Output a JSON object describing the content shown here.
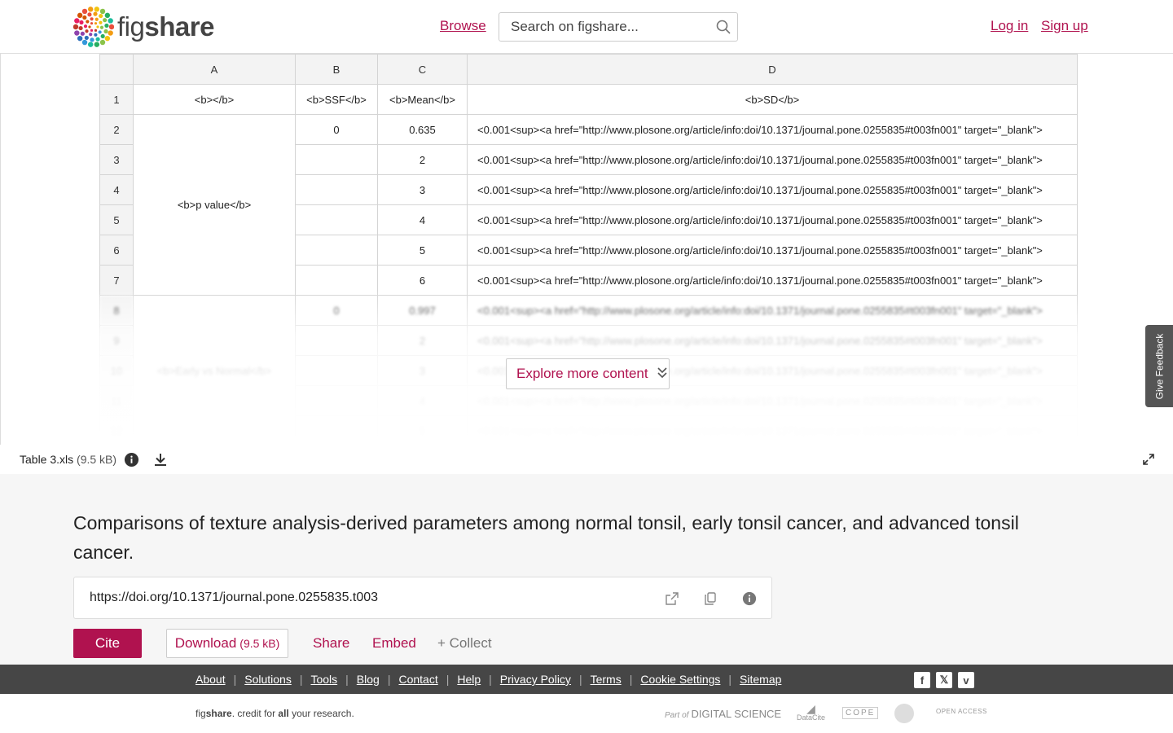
{
  "header": {
    "logo_text_fig": "fig",
    "logo_text_share": "share",
    "browse": "Browse",
    "search_placeholder": "Search on figshare...",
    "login": "Log in",
    "signup": "Sign up"
  },
  "grid": {
    "columns": [
      "A",
      "B",
      "C",
      "D"
    ],
    "header_row": {
      "num": "1",
      "a": "<b></b>",
      "b": "<b>SSF</b>",
      "c": "<b>Mean</b>",
      "d": "<b>SD</b>"
    },
    "merged_a_pvalue": "<b>p value</b>",
    "merged_a_early": "<b>Early vs Normal</b>",
    "sd_text": "<0.001<sup><a href=\"http://www.plosone.org/article/info:doi/10.1371/journal.pone.0255835#t003fn001\" target=\"_blank\">",
    "rows": [
      {
        "num": "2",
        "b": "0",
        "c": "0.635"
      },
      {
        "num": "3",
        "b": "",
        "c": "2"
      },
      {
        "num": "4",
        "b": "",
        "c": "3"
      },
      {
        "num": "5",
        "b": "",
        "c": "4"
      },
      {
        "num": "6",
        "b": "",
        "c": "5"
      },
      {
        "num": "7",
        "b": "",
        "c": "6"
      },
      {
        "num": "8",
        "b": "0",
        "c": "0.997"
      },
      {
        "num": "9",
        "b": "",
        "c": "2"
      },
      {
        "num": "10",
        "b": "",
        "c": "3"
      },
      {
        "num": "11",
        "b": "",
        "c": "4"
      },
      {
        "num": "12",
        "b": "",
        "c": "5"
      }
    ]
  },
  "explore_label": "Explore more content",
  "feedback_label": "Give Feedback",
  "file": {
    "name": "Table 3.xls",
    "size": "(9.5 kB)"
  },
  "article": {
    "title": "Comparisons of texture analysis-derived parameters among normal tonsil, early tonsil cancer, and advanced tonsil cancer.",
    "doi": "https://doi.org/10.1371/journal.pone.0255835.t003"
  },
  "actions": {
    "cite": "Cite",
    "download": "Download",
    "download_size": "(9.5 kB)",
    "share": "Share",
    "embed": "Embed",
    "collect": "+ Collect"
  },
  "footer": {
    "links": [
      "About",
      "Solutions",
      "Tools",
      "Blog",
      "Contact",
      "Help",
      "Privacy Policy",
      "Terms",
      "Cookie Settings",
      "Sitemap"
    ],
    "tag_fig": "fig",
    "tag_share": "share",
    "tag_mid": ". credit for ",
    "tag_all": "all",
    "tag_end": " your research.",
    "partner_ds_prefix": "Part of",
    "partner_ds": "DIGITAL SCIENCE",
    "partner_datacite": "DataCite",
    "partner_cope": "COPE",
    "partner_oa": "OPEN ACCESS",
    "social": [
      "facebook-icon",
      "x-icon",
      "vimeo-icon"
    ]
  },
  "colors": {
    "accent": "#b0124f",
    "footer_bg": "#464646",
    "content_bg": "#f6f6f6"
  }
}
